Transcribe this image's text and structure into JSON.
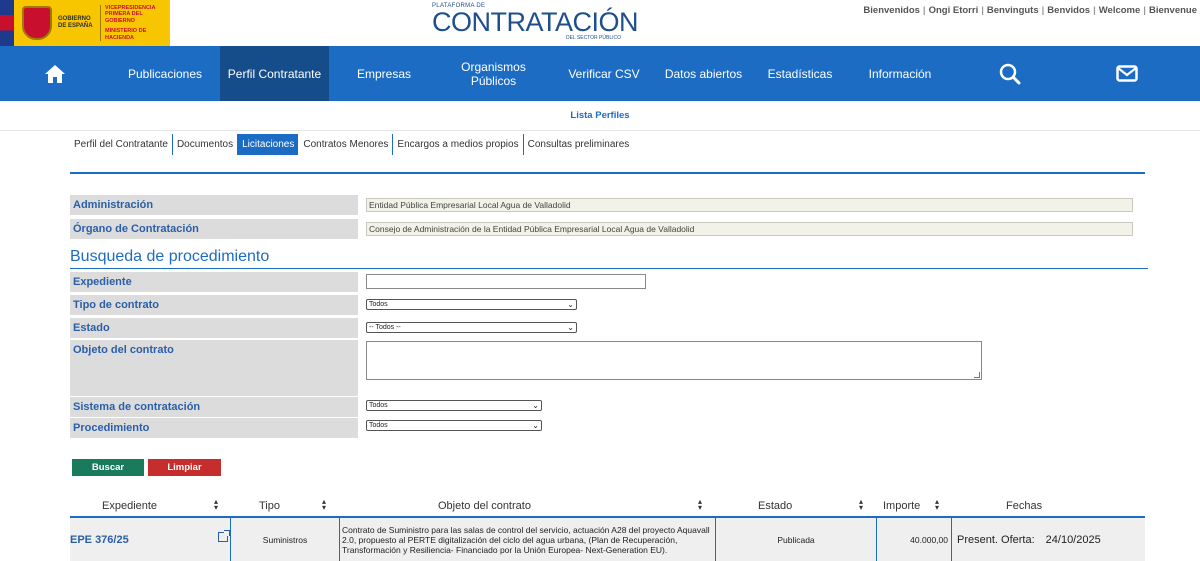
{
  "header": {
    "gov_line1": "GOBIERNO DE ESPAÑA",
    "gov_line2": "VICEPRESIDENCIA PRIMERA DEL GOBIERNO",
    "gov_line3": "MINISTERIO DE HACIENDA",
    "brand_small": "PLATAFORMA DE",
    "brand_main": "CONTRATACIÓN",
    "brand_sub": "DEL SECTOR PÚBLICO",
    "languages": [
      "Bienvenidos",
      "Ongi Etorri",
      "Benvinguts",
      "Benvidos",
      "Welcome",
      "Bienvenue"
    ]
  },
  "nav": {
    "items": [
      "Publicaciones",
      "Perfil Contratante",
      "Empresas",
      "Organismos Públicos",
      "Verificar CSV",
      "Datos abiertos",
      "Estadísticas",
      "Información"
    ],
    "active": "Perfil Contratante"
  },
  "subhead": {
    "link": "Lista Perfiles"
  },
  "tabs": [
    "Perfil del Contratante",
    "Documentos",
    "Licitaciones",
    "Contratos Menores",
    "Encargos a medios propios",
    "Consultas preliminares"
  ],
  "info": {
    "administracion_label": "Administración",
    "administracion_value": "Entidad Pública Empresarial Local Agua de Valladolid",
    "organo_label": "Órgano de Contratación",
    "organo_value": "Consejo de Administración de la Entidad Pública Empresarial Local Agua de Valladolid"
  },
  "search": {
    "title": "Busqueda de procedimiento",
    "expediente_label": "Expediente",
    "expediente_value": "",
    "tipo_label": "Tipo de contrato",
    "tipo_value": "Todos",
    "estado_label": "Estado",
    "estado_value": "-- Todos --",
    "objeto_label": "Objeto del contrato",
    "objeto_value": "",
    "sistema_label": "Sistema de contratación",
    "sistema_value": "Todos",
    "procedimiento_label": "Procedimiento",
    "procedimiento_value": "Todos",
    "buscar_label": "Buscar",
    "limpiar_label": "Limpiar"
  },
  "table": {
    "headers": [
      "Expediente",
      "Tipo",
      "Objeto del contrato",
      "Estado",
      "Importe",
      "Fechas"
    ],
    "rows": [
      {
        "expediente": "EPE 376/25",
        "tipo": "Suministros",
        "objeto": "Contrato de Suministro para las salas de control del servicio, actuación A28 del proyecto Aquavall 2.0, propuesto al PERTE digitalización del ciclo del agua urbana, (Plan de Recuperación, Transformación y Resiliencia- Financiado por la Unión Europea- Next-Generation EU).",
        "estado": "Publicada",
        "importe": "40.000,00",
        "fecha_label": "Present. Oferta:",
        "fecha_value": "24/10/2025"
      }
    ]
  },
  "icons": {
    "home": "home-icon",
    "search": "search-icon",
    "mail": "mail-icon",
    "external": "external-link-icon",
    "sort": "sort-icon"
  }
}
